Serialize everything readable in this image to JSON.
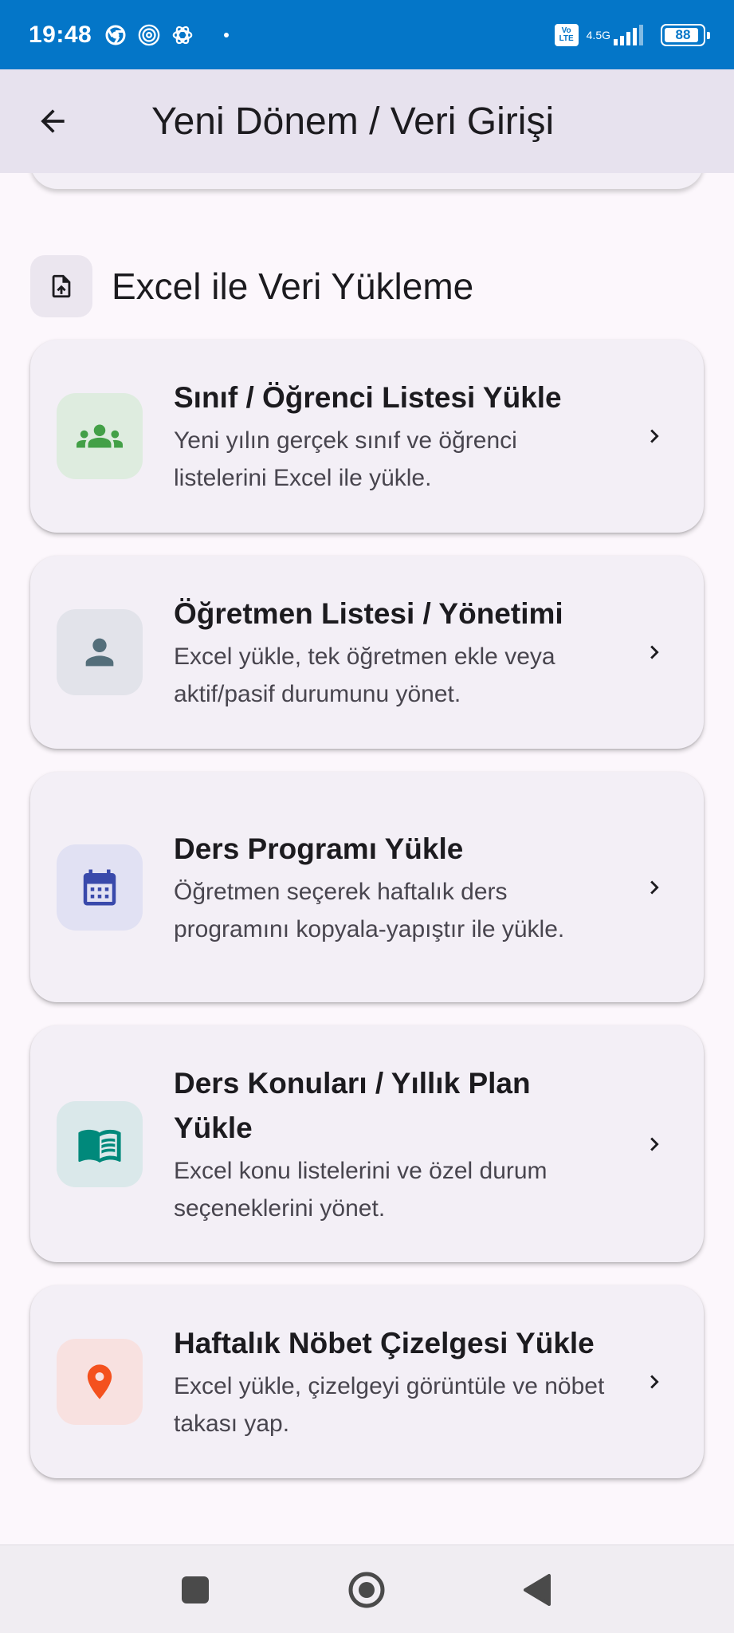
{
  "status_bar": {
    "time": "19:48",
    "volte_top": "Vo",
    "volte_bottom": "LTE",
    "network": "4.5G",
    "battery": "88"
  },
  "app_bar": {
    "title": "Yeni Dönem / Veri Girişi"
  },
  "section": {
    "title": "Excel ile Veri Yükleme"
  },
  "cards": [
    {
      "title": "Sınıf / Öğrenci Listesi Yükle",
      "subtitle": "Yeni yılın gerçek sınıf ve öğrenci listelerini Excel ile yükle.",
      "icon": "groups-icon",
      "icon_color": "#43a047",
      "icon_bg": "#deecdf"
    },
    {
      "title": "Öğretmen Listesi / Yönetimi",
      "subtitle": "Excel yükle, tek öğretmen ekle veya aktif/pasif durumunu yönet.",
      "icon": "person-icon",
      "icon_color": "#546e7a",
      "icon_bg": "#e2e3ea"
    },
    {
      "title": "Ders Programı Yükle",
      "subtitle": "Öğretmen seçerek haftalık ders programını kopyala-yapıştır ile yükle.",
      "icon": "calendar-icon",
      "icon_color": "#3949ab",
      "icon_bg": "#e1e1f3"
    },
    {
      "title": "Ders Konuları / Yıllık Plan Yükle",
      "subtitle": "Excel konu listelerini ve özel durum seçeneklerini yönet.",
      "icon": "book-icon",
      "icon_color": "#00897b",
      "icon_bg": "#dae8ea"
    },
    {
      "title": "Haftalık Nöbet Çizelgesi Yükle",
      "subtitle": "Excel yükle, çizelgeyi görüntüle ve nöbet takası yap.",
      "icon": "location-pin-icon",
      "icon_color": "#f4511e",
      "icon_bg": "#f8e1e0"
    }
  ]
}
